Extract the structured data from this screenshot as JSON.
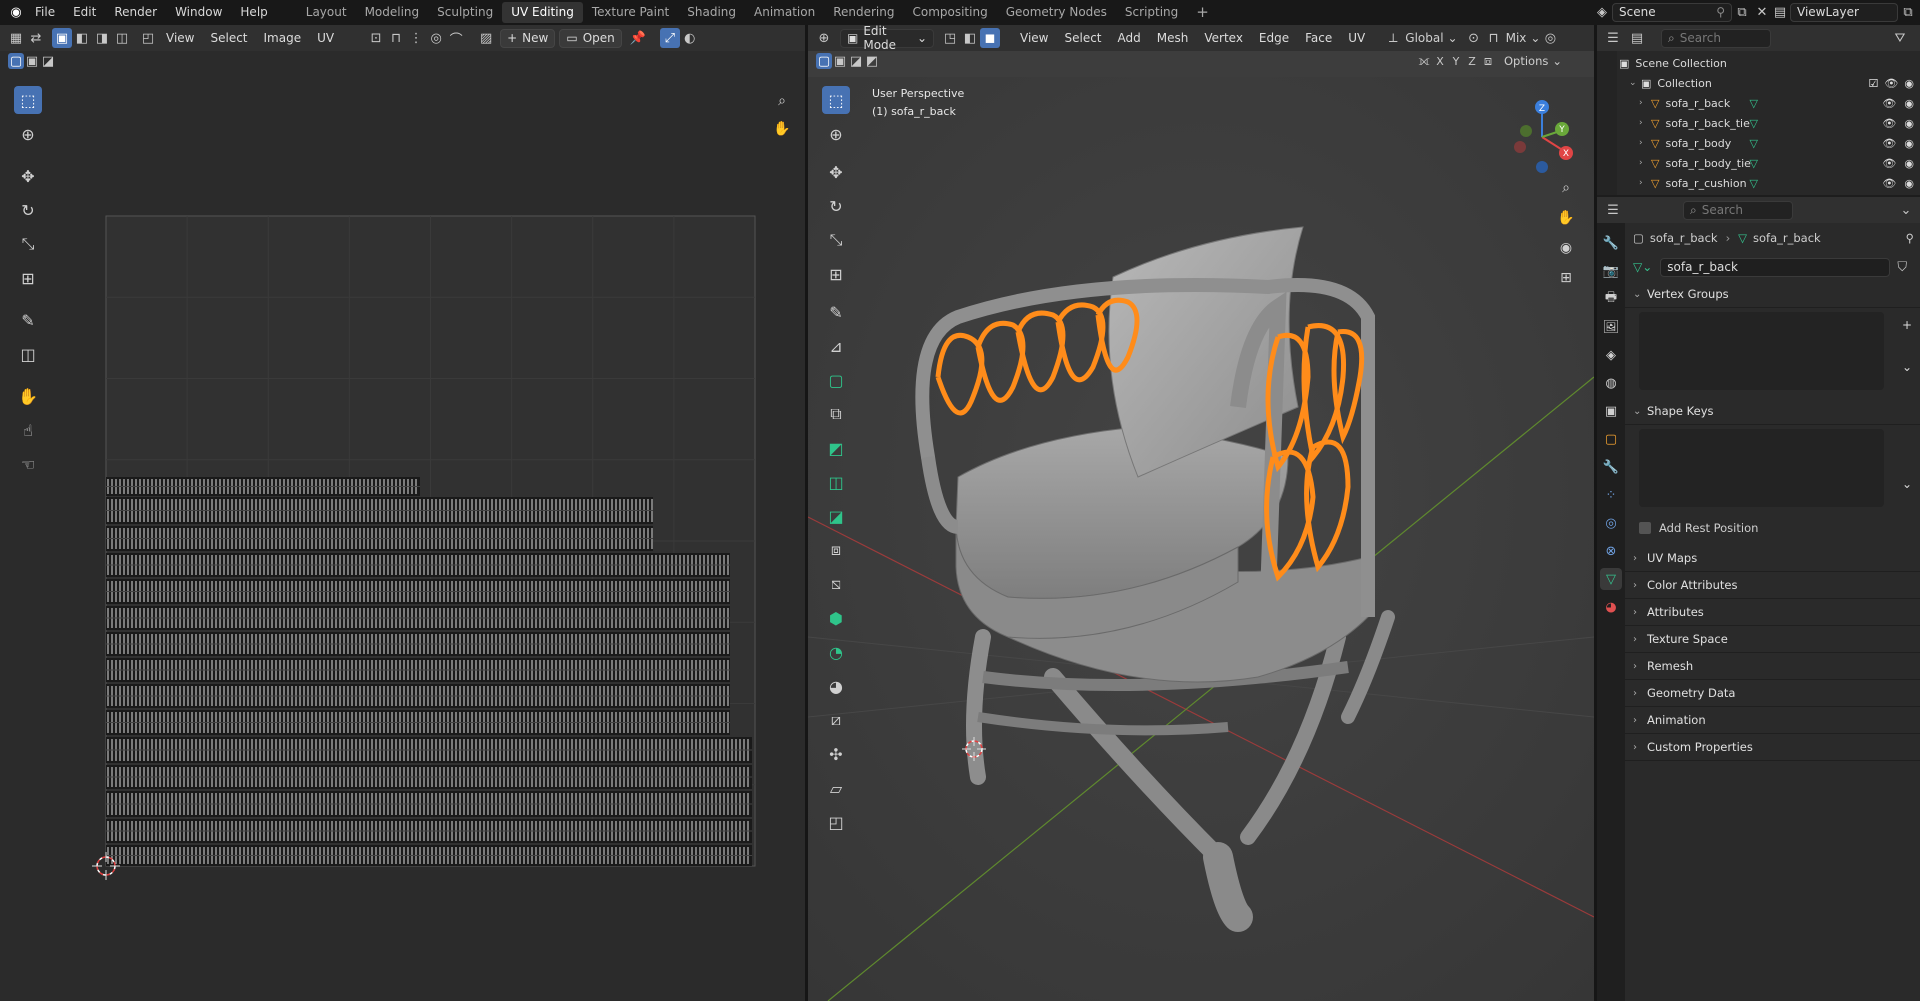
{
  "topbar": {
    "menus": [
      "File",
      "Edit",
      "Render",
      "Window",
      "Help"
    ],
    "tabs": [
      "Layout",
      "Modeling",
      "Sculpting",
      "UV Editing",
      "Texture Paint",
      "Shading",
      "Animation",
      "Rendering",
      "Compositing",
      "Geometry Nodes",
      "Scripting"
    ],
    "active_tab": "UV Editing",
    "add_tab": "+",
    "scene_label": "Scene",
    "viewlayer_label": "ViewLayer"
  },
  "uv_editor": {
    "menus": [
      "View",
      "Select",
      "Image",
      "UV"
    ],
    "new_label": "New",
    "open_label": "Open"
  },
  "viewport": {
    "mode_label": "Edit Mode",
    "menus": [
      "View",
      "Select",
      "Add",
      "Mesh",
      "Vertex",
      "Edge",
      "Face",
      "UV"
    ],
    "orientation_label": "Global",
    "mix_label": "Mix",
    "axes": [
      "X",
      "Y",
      "Z"
    ],
    "options_label": "Options",
    "overlay_line1": "User Perspective",
    "overlay_line2": "(1) sofa_r_back",
    "gizmo_labels": {
      "x": "X",
      "y": "Y",
      "z": "Z"
    }
  },
  "outliner": {
    "search_placeholder": "Search",
    "scene_collection": "Scene Collection",
    "collection": "Collection",
    "objects": [
      "sofa_r_back",
      "sofa_r_back_tie",
      "sofa_r_body",
      "sofa_r_body_tie",
      "sofa_r_cushion"
    ]
  },
  "properties": {
    "search_placeholder": "Search",
    "breadcrumb_object": "sofa_r_back",
    "breadcrumb_mesh": "sofa_r_back",
    "datablock_name": "sofa_r_back",
    "vertex_groups": "Vertex Groups",
    "shape_keys": "Shape Keys",
    "add_rest_position": "Add Rest Position",
    "panels": [
      "UV Maps",
      "Color Attributes",
      "Attributes",
      "Texture Space",
      "Remesh",
      "Geometry Data",
      "Animation",
      "Custom Properties"
    ]
  },
  "colors": {
    "selection_orange": "#ff8c1a",
    "active_blue": "#4772b3",
    "mesh_green": "#35c48f"
  }
}
